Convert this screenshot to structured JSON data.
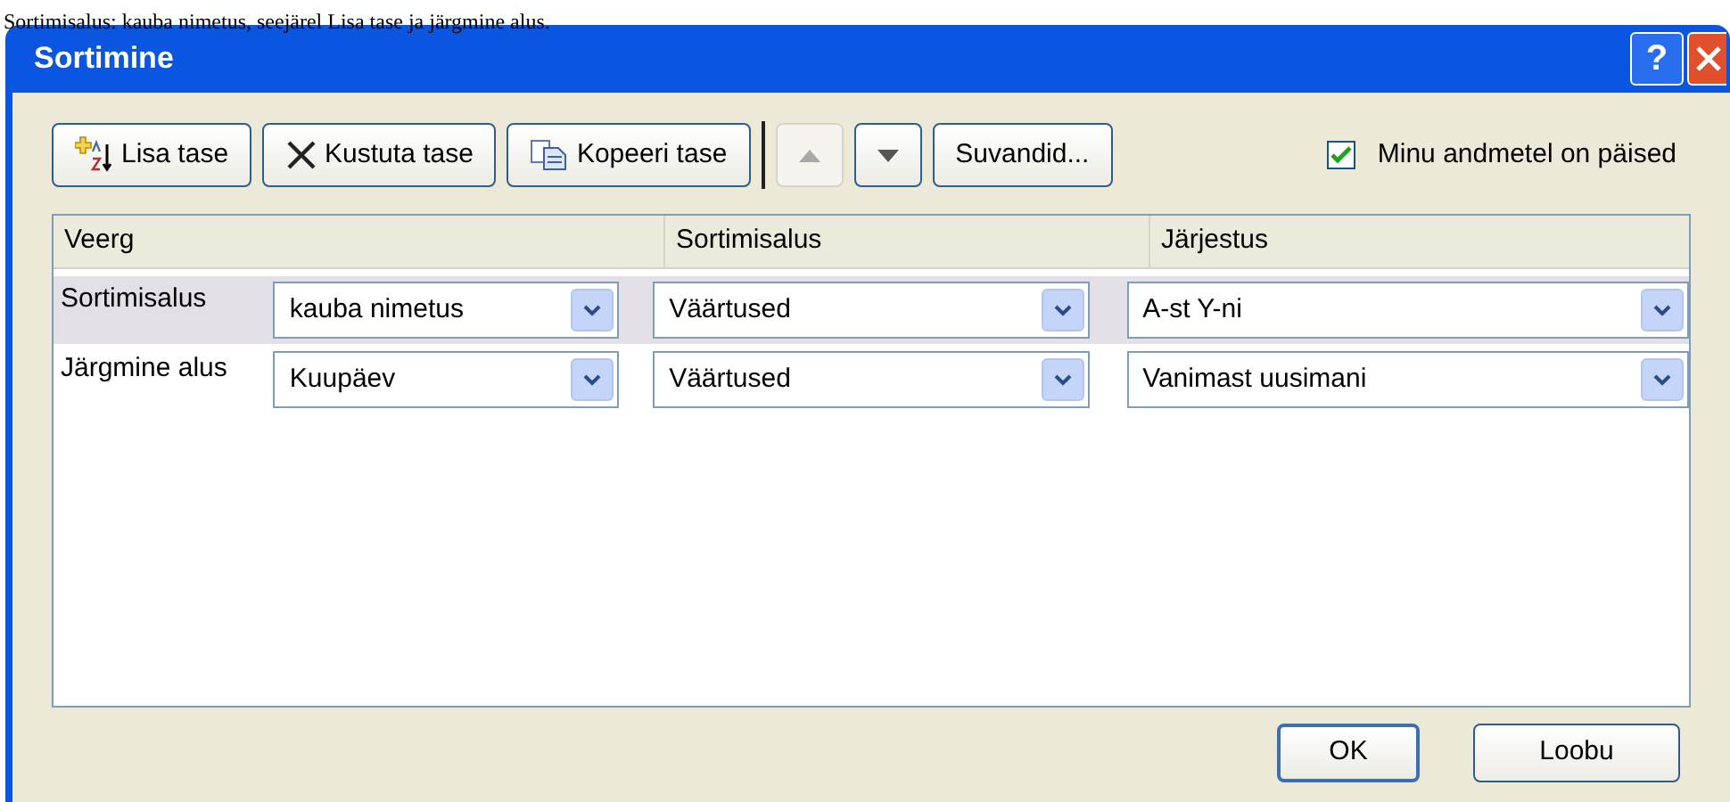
{
  "document_text": "Sortimisalus: kauba nimetus, seejärel Lisa tase ja järgmine alus.",
  "window": {
    "title": "Sortimine",
    "help": "?"
  },
  "toolbar": {
    "buttons": [
      {
        "kind": "add",
        "label": "Lisa tase",
        "disabled": false
      },
      {
        "kind": "delete",
        "label": "Kustuta tase",
        "disabled": false
      },
      {
        "kind": "copy",
        "label": "Kopeeri tase",
        "disabled": false
      },
      {
        "kind": "up",
        "disabled": true
      },
      {
        "kind": "down",
        "disabled": false
      },
      {
        "kind": "text",
        "label": "Suvandid...",
        "disabled": false
      }
    ],
    "headers_checkbox": {
      "label": "Minu andmetel on päised",
      "checked": true
    }
  },
  "table": {
    "columns": [
      "Veerg",
      "Sortimisalus",
      "Järjestus"
    ],
    "rows": [
      {
        "label": "Sortimisalus",
        "column": "kauba nimetus",
        "basis": "Väärtused",
        "order": "A-st Y-ni",
        "selected": true
      },
      {
        "label": "Järgmine alus",
        "column": "Kuupäev",
        "basis": "Väärtused",
        "order": "Vanimast uusimani",
        "selected": false
      }
    ]
  },
  "buttons": [
    "OK",
    "Loobu"
  ]
}
